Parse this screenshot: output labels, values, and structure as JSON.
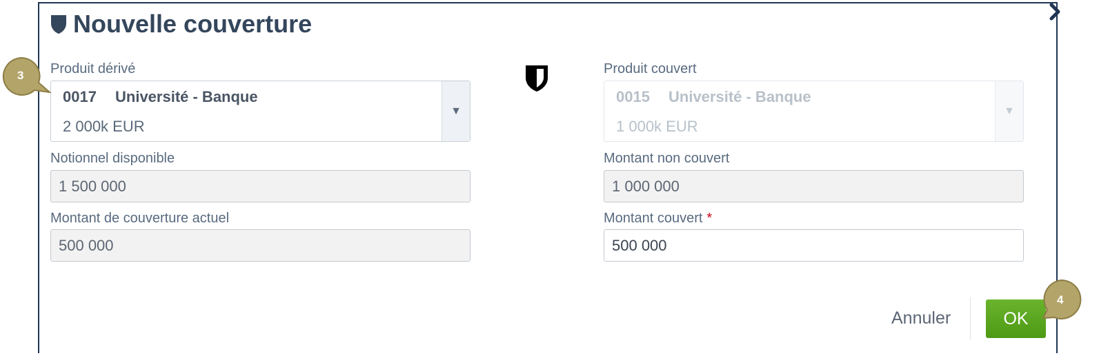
{
  "dialog": {
    "title": "Nouvelle couverture",
    "icon": "shield-icon",
    "close_icon": "close-icon"
  },
  "left": {
    "derivative_label": "Produit dérivé",
    "derivative": {
      "code": "0017",
      "name": "Université - Banque",
      "amount": "2 000k EUR",
      "arrow": "▼"
    },
    "notional_label": "Notionnel disponible",
    "notional_value": "1 500 000",
    "current_coverage_label": "Montant de couverture actuel",
    "current_coverage_value": "500 000"
  },
  "right": {
    "hedged_label": "Produit couvert",
    "hedged": {
      "code": "0015",
      "name": "Université - Banque",
      "amount": "1 000k EUR",
      "arrow": "▼"
    },
    "uncovered_label": "Montant non couvert",
    "uncovered_value": "1 000 000",
    "covered_label": "Montant couvert",
    "covered_required": "*",
    "covered_value": "500 000"
  },
  "buttons": {
    "cancel_label": "Annuler",
    "ok_label": "OK"
  },
  "callouts": {
    "step3": "3",
    "step4": "4",
    "color": "#b3a46a"
  },
  "colors": {
    "ok_button": "#5aa71f",
    "border": "#1f3553",
    "required": "#d0021b"
  }
}
